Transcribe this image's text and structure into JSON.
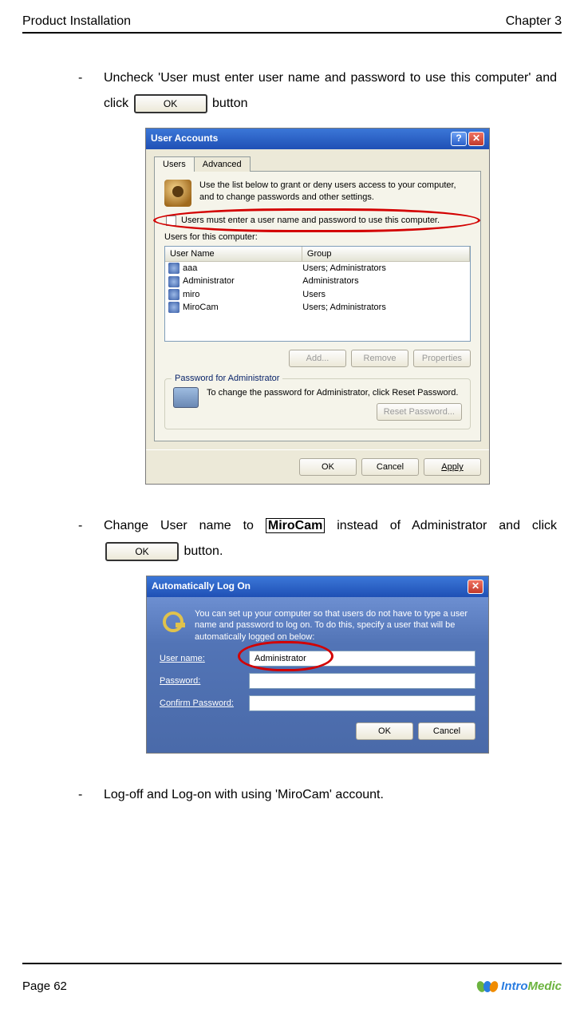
{
  "header": {
    "left": "Product Installation",
    "right": "Chapter 3"
  },
  "bullets": {
    "b1_pre": "Uncheck 'User must enter user name and password to use this computer' and click ",
    "b1_post": " button",
    "b2_pre": "Change User name to ",
    "b2_boxed": "MiroCam",
    "b2_mid": " instead of Administrator and click ",
    "b2_post": " button.",
    "b3": "Log-off and Log-on with using 'MiroCam' account."
  },
  "ok_label": "OK",
  "dlg1": {
    "title": "User Accounts",
    "tabs": {
      "users": "Users",
      "advanced": "Advanced"
    },
    "intro": "Use the list below to grant or deny users access to your computer, and to change passwords and other settings.",
    "checkbox": "Users must enter a user name and password to use this computer.",
    "list_caption": "Users for this computer:",
    "cols": {
      "name": "User Name",
      "group": "Group"
    },
    "rows": [
      {
        "name": "aaa",
        "group": "Users; Administrators"
      },
      {
        "name": "Administrator",
        "group": "Administrators"
      },
      {
        "name": "miro",
        "group": "Users"
      },
      {
        "name": "MiroCam",
        "group": "Users; Administrators"
      }
    ],
    "btns": {
      "add": "Add...",
      "remove": "Remove",
      "properties": "Properties"
    },
    "pw_legend": "Password for Administrator",
    "pw_text": "To change the password for Administrator, click Reset Password.",
    "reset": "Reset Password...",
    "footer": {
      "ok": "OK",
      "cancel": "Cancel",
      "apply": "Apply"
    }
  },
  "dlg2": {
    "title": "Automatically Log On",
    "intro": "You can set up your computer so that users do not have to type a user name and password to log on. To do this, specify a user that will be automatically logged on below:",
    "labels": {
      "user": "User name:",
      "pw": "Password:",
      "cpw": "Confirm Password:"
    },
    "values": {
      "user": "Administrator",
      "pw": "",
      "cpw": ""
    },
    "footer": {
      "ok": "OK",
      "cancel": "Cancel"
    }
  },
  "footer": {
    "page": "Page 62",
    "logo_a": "Intro",
    "logo_b": "Medic"
  }
}
